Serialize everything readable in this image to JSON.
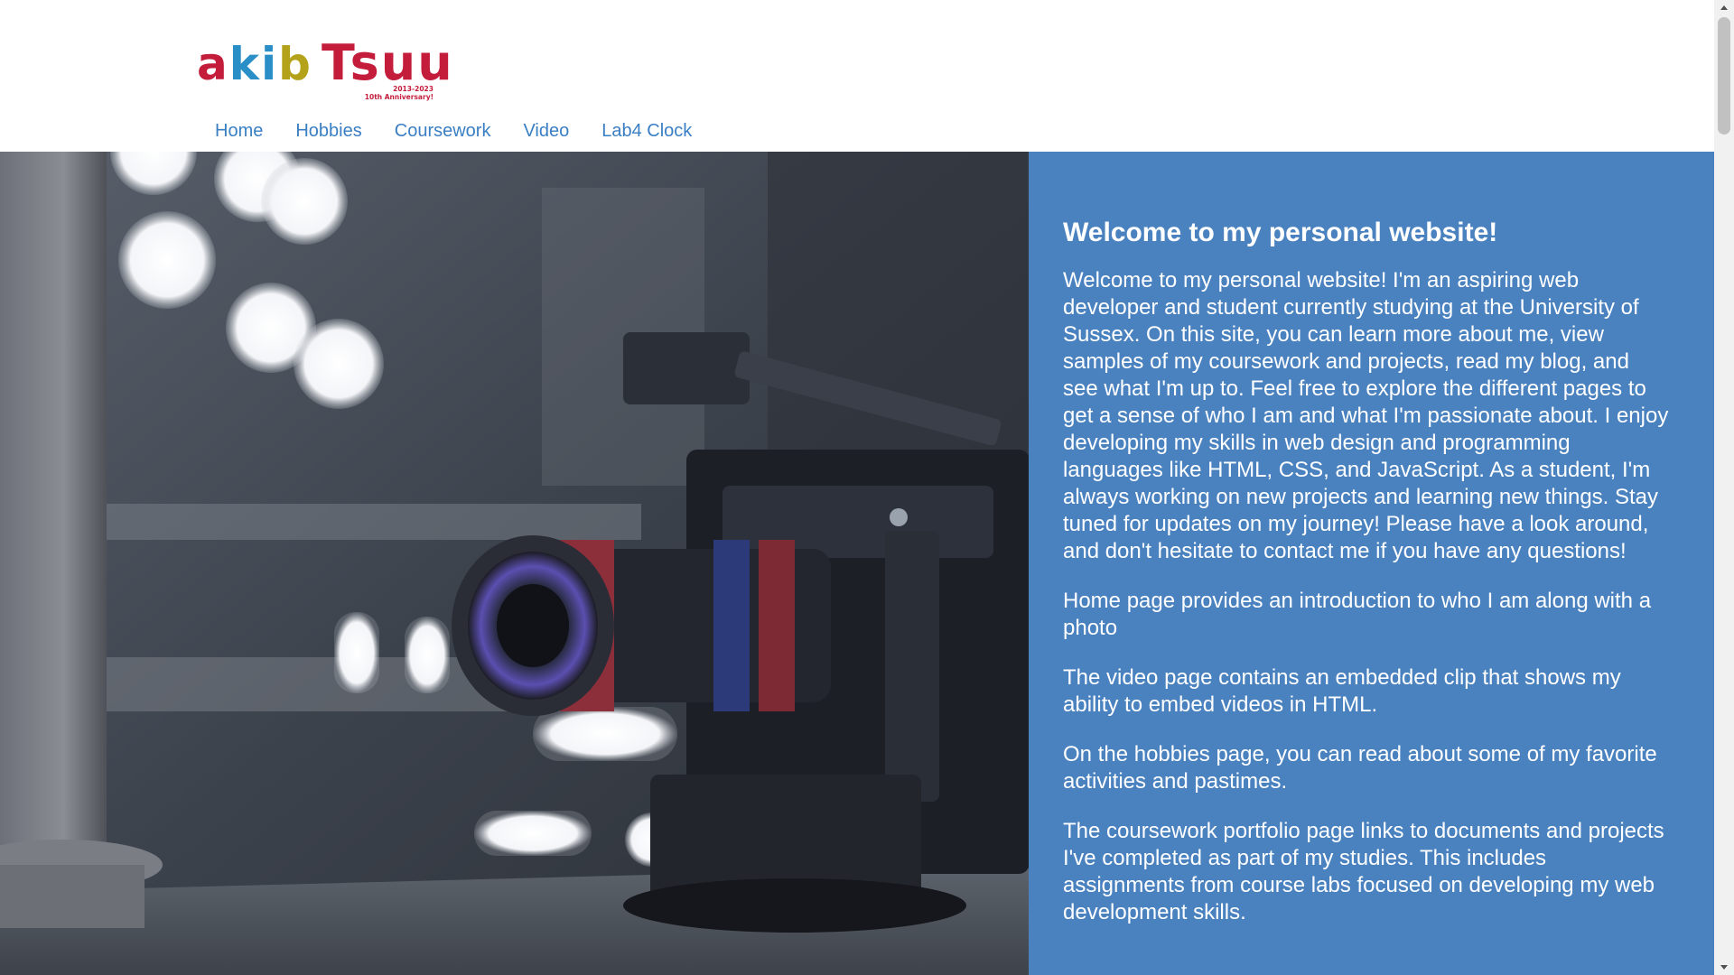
{
  "logo": {
    "text_a": "a",
    "text_k": "k",
    "text_i": "i",
    "text_b": "b",
    "text_tsuu": "Tsuu",
    "years": "2013-2023",
    "anniversary": "10th Anniversary!"
  },
  "nav": {
    "items": [
      {
        "label": "Home"
      },
      {
        "label": "Hobbies"
      },
      {
        "label": "Coursework"
      },
      {
        "label": "Video"
      },
      {
        "label": "Lab4 Clock"
      }
    ]
  },
  "hero": {
    "image_icon": "camera-photo",
    "heading": "Welcome to my personal website!",
    "paragraphs": [
      "Welcome to my personal website! I'm an aspiring web developer and student currently studying at the University of Sussex. On this site, you can learn more about me, view samples of my coursework and projects, read my blog, and see what I'm up to. Feel free to explore the different pages to get a sense of who I am and what I'm passionate about. I enjoy developing my skills in web design and programming languages like HTML, CSS, and JavaScript. As a student, I'm always working on new projects and learning new things. Stay tuned for updates on my journey! Please have a look around, and don't hesitate to contact me if you have any questions!",
      "Home page provides an introduction to who I am along with a photo",
      "The video page contains an embedded clip that shows my ability to embed videos in HTML.",
      "On the hobbies page, you can read about some of my favorite activities and pastimes.",
      "The coursework portfolio page links to documents and projects I've completed as part of my studies. This includes assignments from course labs focused on developing my web development skills."
    ]
  },
  "colors": {
    "panel_bg": "#4a82c0",
    "nav_link": "#3a7fc4",
    "logo_red": "#c41d3c",
    "logo_blue": "#2b8fc7",
    "logo_olive": "#b5a21b"
  }
}
